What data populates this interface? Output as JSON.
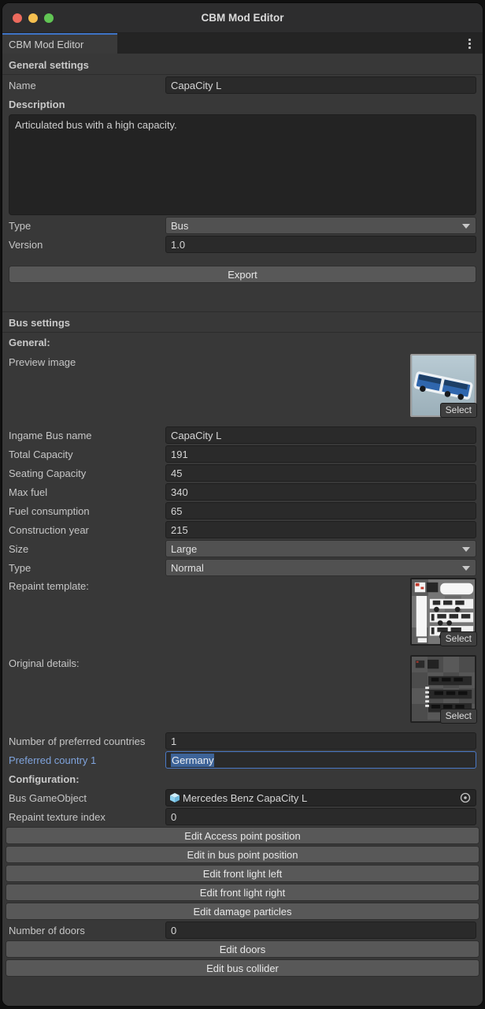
{
  "colors": {
    "accent_blue": "#3e74c6",
    "label_blue": "#7fa3dc",
    "selection_blue": "#3d6398",
    "traffic_red": "#ec6a5d",
    "traffic_yellow": "#f5bf4f",
    "traffic_green": "#61c554",
    "window_bg": "#383838",
    "field_bg": "#2a2a2a",
    "button_bg": "#585858"
  },
  "window": {
    "title": "CBM Mod Editor"
  },
  "tabbar": {
    "tab": "CBM Mod Editor"
  },
  "icons": {
    "kebab_menu": "vertical-three-dots",
    "dropdown_arrow": "down-triangle",
    "prefab_cube": "blue-cube",
    "object_picker": "circle-with-dot"
  },
  "general": {
    "header": "General settings",
    "name": {
      "label": "Name",
      "value": "CapaCity L"
    },
    "description": {
      "label": "Description",
      "value": "Articulated bus with a high capacity."
    },
    "type": {
      "label": "Type",
      "value": "Bus"
    },
    "version": {
      "label": "Version",
      "value": "1.0"
    },
    "export_button": "Export"
  },
  "bus": {
    "header": "Bus settings",
    "general_heading": "General:",
    "preview_image": {
      "label": "Preview image",
      "select": "Select"
    },
    "ingame_name": {
      "label": "Ingame Bus name",
      "value": "CapaCity L"
    },
    "total_capacity": {
      "label": "Total Capacity",
      "value": "191"
    },
    "seating_capacity": {
      "label": "Seating Capacity",
      "value": "45"
    },
    "max_fuel": {
      "label": "Max fuel",
      "value": "340"
    },
    "fuel_consumption": {
      "label": "Fuel consumption",
      "value": "65"
    },
    "construction_year": {
      "label": "Construction year",
      "value": "215"
    },
    "size": {
      "label": "Size",
      "value": "Large"
    },
    "type": {
      "label": "Type",
      "value": "Normal"
    },
    "repaint_template": {
      "label": "Repaint template:",
      "select": "Select"
    },
    "original_details": {
      "label": "Original details:",
      "select": "Select"
    },
    "preferred_countries_count": {
      "label": "Number of preferred countries",
      "value": "1"
    },
    "preferred_country_1": {
      "label": "Preferred country 1",
      "value": "Germany"
    },
    "configuration_heading": "Configuration:",
    "bus_gameobject": {
      "label": "Bus GameObject",
      "value": "Mercedes Benz CapaCity L"
    },
    "repaint_texture_index": {
      "label": "Repaint texture index",
      "value": "0"
    },
    "buttons": {
      "edit_access_point": "Edit Access point position",
      "edit_in_bus_point": "Edit in bus point position",
      "edit_front_light_left": "Edit front light left",
      "edit_front_light_right": "Edit front light right",
      "edit_damage_particles": "Edit damage particles"
    },
    "number_of_doors": {
      "label": "Number of doors",
      "value": "0"
    },
    "edit_doors_button": "Edit doors",
    "edit_bus_collider_button": "Edit bus collider"
  }
}
